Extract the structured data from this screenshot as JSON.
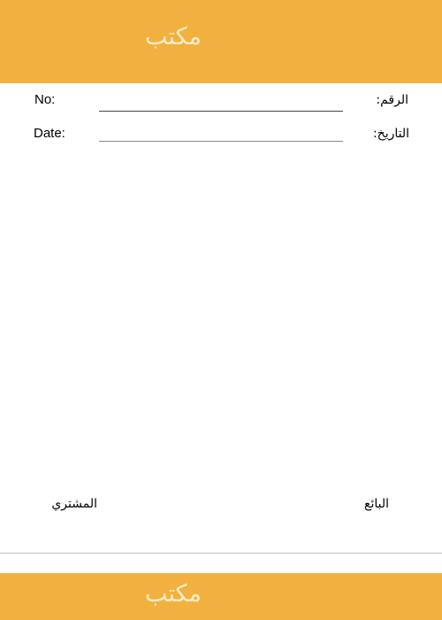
{
  "header": {
    "title": "مكتب"
  },
  "fields": {
    "number_label_en": "No:",
    "number_label_ar": "الرقم:",
    "number_value": "",
    "date_label_en": "Date:",
    "date_label_ar": "التاريخ:",
    "date_value": ""
  },
  "signatures": {
    "seller": "البائع",
    "buyer": "المشتري"
  },
  "footer": {
    "title": "مكتب"
  },
  "colors": {
    "brand": "#F2B13E",
    "brand_text": "#FBEBCB"
  }
}
